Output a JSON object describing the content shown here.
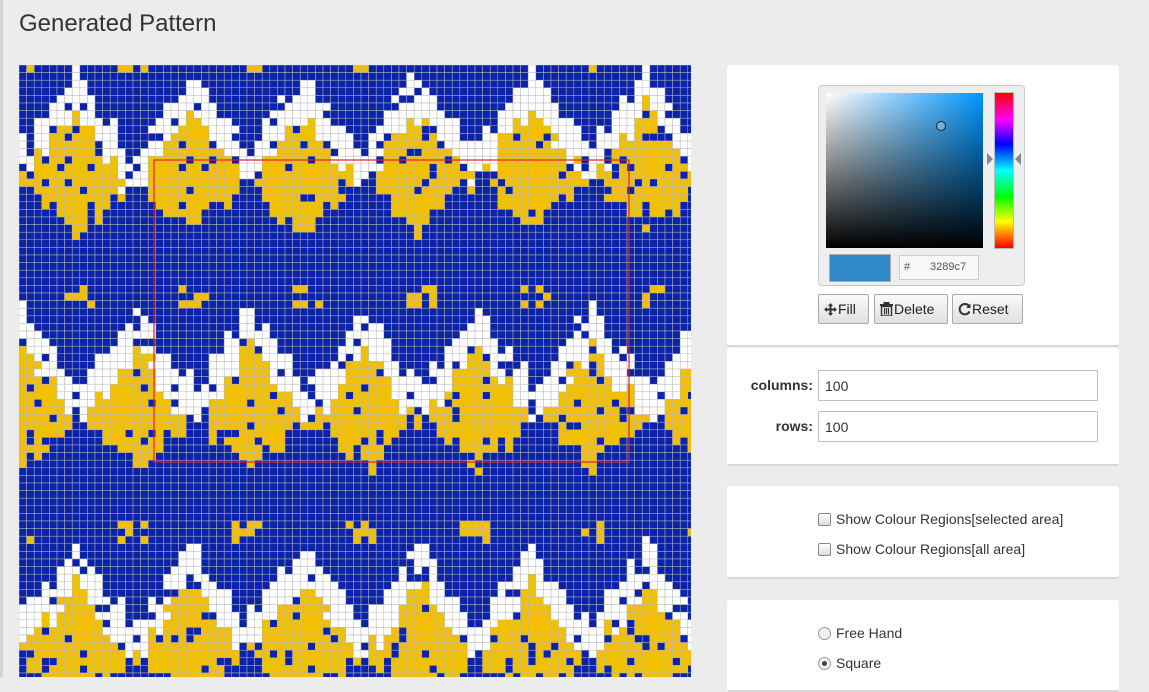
{
  "page": {
    "title": "Generated Pattern"
  },
  "pattern": {
    "colors": {
      "background": "#0a23a8",
      "accent": "#f2c000",
      "light": "#ffffff",
      "grid_line": "#b8b8b8",
      "selection": "#e02020"
    },
    "selection_visible": true
  },
  "color_picker": {
    "hash": "#",
    "hex": "3289c7",
    "swatch_color": "#3289c7",
    "buttons": {
      "fill": "Fill",
      "delete": "Delete",
      "reset": "Reset"
    }
  },
  "dimensions": {
    "columns_label": "columns:",
    "columns_value": "100",
    "rows_label": "rows:",
    "rows_value": "100"
  },
  "regions": {
    "selected_label": "Show Colour Regions[selected area]",
    "selected_checked": false,
    "all_label": "Show Colour Regions[all area]",
    "all_checked": false
  },
  "draw_mode": {
    "free_hand_label": "Free Hand",
    "square_label": "Square",
    "selected": "Square"
  }
}
